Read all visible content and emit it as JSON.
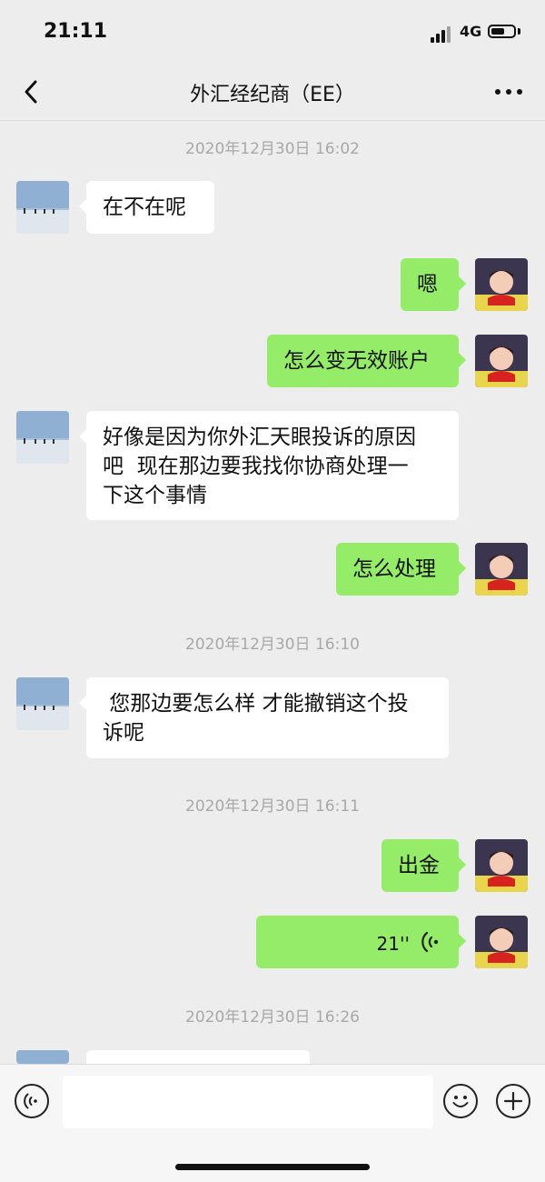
{
  "status_bar": {
    "time": "21:11",
    "network": "4G"
  },
  "nav": {
    "title": "外汇经纪商（EE）",
    "back_icon": "chevron-left-icon",
    "more_icon": "more-dots-icon"
  },
  "messages": [
    {
      "type": "timestamp",
      "text": "2020年12月30日 16:02"
    },
    {
      "type": "incoming",
      "text": "在不在呢"
    },
    {
      "type": "outgoing",
      "text": "嗯"
    },
    {
      "type": "outgoing",
      "text": "怎么变无效账户"
    },
    {
      "type": "incoming",
      "lines": [
        "好像是因为你外汇天眼投诉的原因",
        "吧  现在那边要我找你协商处理一",
        "下这个事情"
      ]
    },
    {
      "type": "outgoing",
      "text": "怎么处理"
    },
    {
      "type": "timestamp",
      "text": "2020年12月30日 16:10"
    },
    {
      "type": "incoming",
      "lines": [
        " 您那边要怎么样 才能撤销这个投",
        "诉呢"
      ]
    },
    {
      "type": "timestamp",
      "text": "2020年12月30日 16:11"
    },
    {
      "type": "outgoing",
      "text": "出金"
    },
    {
      "type": "outgoing_voice",
      "duration": "21''"
    },
    {
      "type": "timestamp",
      "text": "2020年12月30日 16:26"
    }
  ],
  "input_bar": {
    "voice_icon": "voice-mode-icon",
    "emoji_icon": "emoji-icon",
    "plus_icon": "plus-icon",
    "placeholder": ""
  },
  "colors": {
    "background": "#ededed",
    "outgoing_bubble": "#95ec69",
    "incoming_bubble": "#ffffff",
    "timestamp": "#a8a8a8"
  }
}
